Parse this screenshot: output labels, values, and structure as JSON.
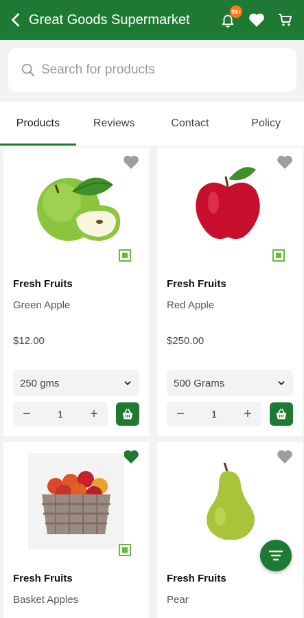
{
  "colors": {
    "primary": "#1e7a32",
    "badge": "#ff7a1a",
    "veg": "#66bb3a"
  },
  "header": {
    "title": "Great Goods Supermarket",
    "notification_badge": "99+",
    "icons": [
      "back-arrow-icon",
      "bell-icon",
      "heart-icon",
      "cart-icon"
    ]
  },
  "search": {
    "placeholder": "Search for products"
  },
  "tabs": [
    {
      "label": "Products",
      "active": true
    },
    {
      "label": "Reviews",
      "active": false
    },
    {
      "label": "Contact",
      "active": false
    },
    {
      "label": "Policy",
      "active": false
    }
  ],
  "products": [
    {
      "category": "Fresh Fruits",
      "name": "Green Apple",
      "price": "$12.00",
      "size": "250 gms",
      "qty": "1",
      "favorite": false
    },
    {
      "category": "Fresh Fruits",
      "name": "Red Apple",
      "price": "$250.00",
      "size": "500 Grams",
      "qty": "1",
      "favorite": false
    },
    {
      "category": "Fresh Fruits",
      "name": "Basket Apples",
      "favorite": true
    },
    {
      "category": "Fresh Fruits",
      "name": "Pear",
      "favorite": false
    }
  ],
  "stepper": {
    "minus": "−",
    "plus": "+"
  }
}
